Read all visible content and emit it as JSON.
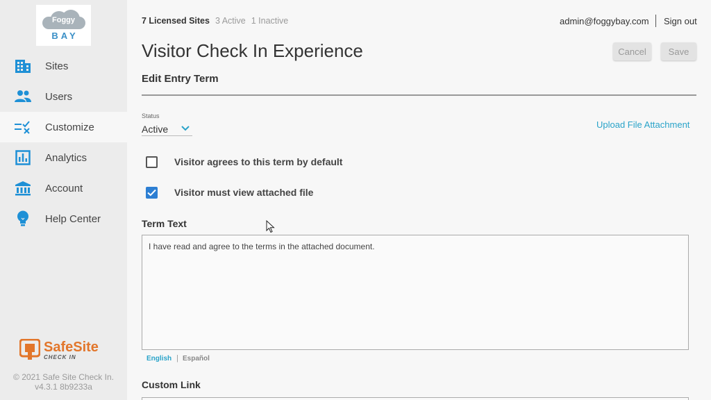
{
  "sidebar": {
    "logo": {
      "top_text": "Foggy",
      "bottom_text": "BAY"
    },
    "items": [
      {
        "label": "Sites",
        "icon": "building-icon",
        "active": false
      },
      {
        "label": "Users",
        "icon": "users-icon",
        "active": false
      },
      {
        "label": "Customize",
        "icon": "customize-icon",
        "active": true
      },
      {
        "label": "Analytics",
        "icon": "analytics-icon",
        "active": false
      },
      {
        "label": "Account",
        "icon": "bank-icon",
        "active": false
      },
      {
        "label": "Help Center",
        "icon": "lightbulb-icon",
        "active": false
      }
    ],
    "brand": {
      "name": "SafeSite",
      "sub": "CHECK IN"
    },
    "copyright": "© 2021 Safe Site Check In.",
    "version": "v4.3.1 8b9233a"
  },
  "header": {
    "licensed": "7 Licensed Sites",
    "active_count": "3 Active",
    "inactive_count": "1 Inactive",
    "email": "admin@foggybay.com",
    "signout": "Sign out"
  },
  "page": {
    "title": "Visitor Check In Experience",
    "cancel_label": "Cancel",
    "save_label": "Save",
    "section_title": "Edit Entry Term"
  },
  "form": {
    "status_label": "Status",
    "status_value": "Active",
    "upload_label": "Upload File Attachment",
    "checkbox_default": {
      "label": "Visitor agrees to this term by default",
      "checked": false
    },
    "checkbox_view": {
      "label": "Visitor must view attached file",
      "checked": true
    },
    "term_text_label": "Term Text",
    "term_text_value": "I have read and agree to the terms in the attached document.",
    "languages": {
      "english": "English",
      "separator": "|",
      "spanish": "Español"
    },
    "custom_link_label": "Custom Link"
  },
  "colors": {
    "accent": "#29a3c9",
    "checkbox": "#2d7fd3",
    "nav_icon": "#1e90d6",
    "brand": "#e2762b"
  }
}
